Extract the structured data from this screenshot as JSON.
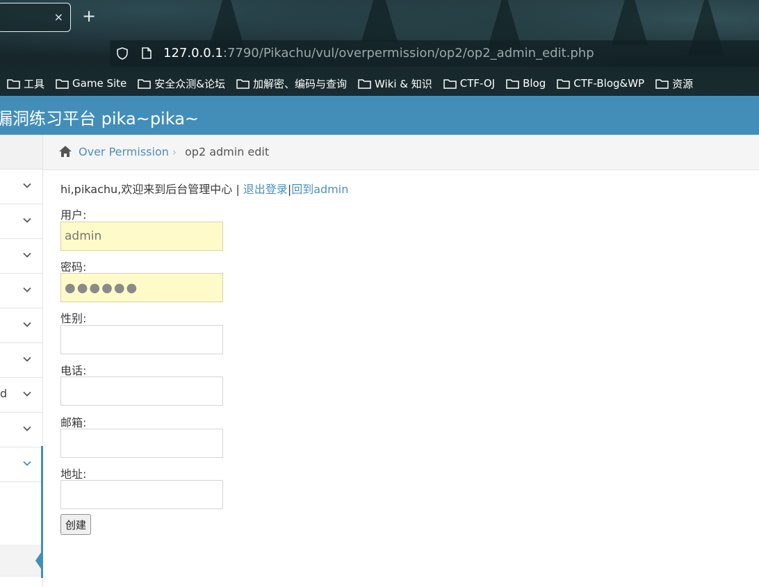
{
  "browser": {
    "tab_close": "×",
    "new_tab": "+",
    "url_host": "127.0.0.1",
    "url_rest": ":7790/Pikachu/vul/overpermission/op2/op2_admin_edit.php",
    "bookmarks": [
      "工具",
      "Game Site",
      "安全众测&论坛",
      "加解密、编码与查询",
      "Wiki & 知识",
      "CTF-OJ",
      "Blog",
      "CTF-Blog&WP",
      "资源"
    ]
  },
  "header": {
    "title": "漏洞练习平台 pika~pika~"
  },
  "sidebar": {
    "fragment": "d"
  },
  "breadcrumb": {
    "section": "Over Permission",
    "separator": "›",
    "current": "op2 admin edit"
  },
  "greeting": {
    "text": "hi,pikachu,欢迎来到后台管理中心 | ",
    "logout": "退出登录",
    "divider": "|",
    "back": "回到admin"
  },
  "form": {
    "username_label": "用户:",
    "username_placeholder": "admin",
    "password_label": "密码:",
    "password_value": "●●●●●●",
    "sex_label": "性别:",
    "phone_label": "电话:",
    "email_label": "邮箱:",
    "address_label": "地址:",
    "submit_label": "创建"
  },
  "colors": {
    "header_bg": "#438eb9",
    "link": "#4c8fbd",
    "autofill_bg": "#fffbc9"
  }
}
